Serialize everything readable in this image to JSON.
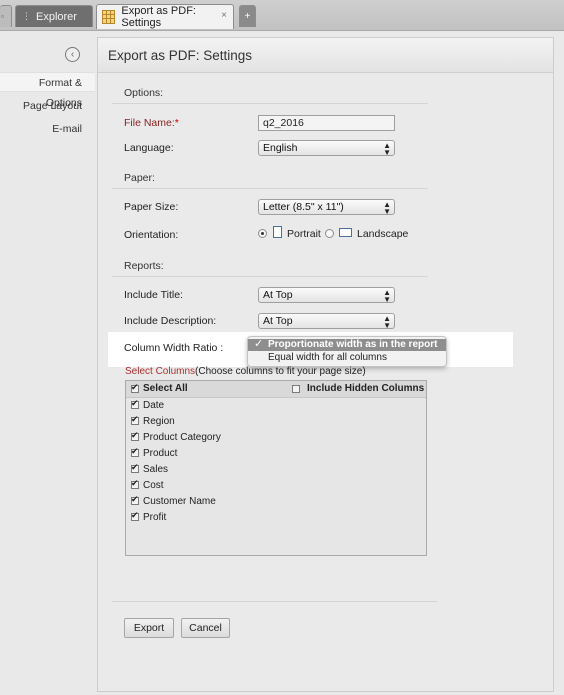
{
  "tabs": {
    "explorer_label": "Explorer",
    "settings_label": "Export as PDF: Settings",
    "close_glyph": "×",
    "new_tab_glyph": "+"
  },
  "sidebar": {
    "back_glyph": "‹",
    "items": [
      {
        "label": "Format & Options",
        "active": true
      },
      {
        "label": "Page Layout",
        "active": false
      },
      {
        "label": "E-mail",
        "active": false
      }
    ]
  },
  "panel": {
    "title": "Export as PDF: Settings"
  },
  "options": {
    "section_label": "Options:",
    "file_name_label": "File Name:",
    "required_mark": "*",
    "file_name_value": "q2_2016",
    "language_label": "Language:",
    "language_value": "English"
  },
  "paper": {
    "section_label": "Paper:",
    "size_label": "Paper Size:",
    "size_value": "Letter (8.5\" x 11\")",
    "orientation_label": "Orientation:",
    "portrait_label": "Portrait",
    "landscape_label": "Landscape",
    "selected": "Portrait"
  },
  "reports": {
    "section_label": "Reports:",
    "include_title_label": "Include Title:",
    "include_title_value": "At Top",
    "include_desc_label": "Include Description:",
    "include_desc_value": "At Top",
    "col_width_label": "Column Width Ratio :",
    "col_width_options": [
      "Proportionate width as in the report",
      "Equal width for all columns"
    ],
    "col_width_selected": "Proportionate width as in the report",
    "check_glyph": "✓"
  },
  "columns": {
    "label_red": "Select Columns",
    "label_hint": "(Choose columns to fit your page size)",
    "select_all_label": "Select All",
    "include_hidden_label": "Include Hidden Columns",
    "items": [
      {
        "label": "Date",
        "checked": true
      },
      {
        "label": "Region",
        "checked": true
      },
      {
        "label": "Product Category",
        "checked": true
      },
      {
        "label": "Product",
        "checked": true
      },
      {
        "label": "Sales",
        "checked": true
      },
      {
        "label": "Cost",
        "checked": true
      },
      {
        "label": "Customer Name",
        "checked": true
      },
      {
        "label": "Profit",
        "checked": true
      }
    ]
  },
  "buttons": {
    "export_label": "Export",
    "cancel_label": "Cancel"
  },
  "colors": {
    "required_label": "#8a1f1f",
    "dropdown_selected": "#8e8e8e",
    "select_columns_label": "#b03030"
  }
}
